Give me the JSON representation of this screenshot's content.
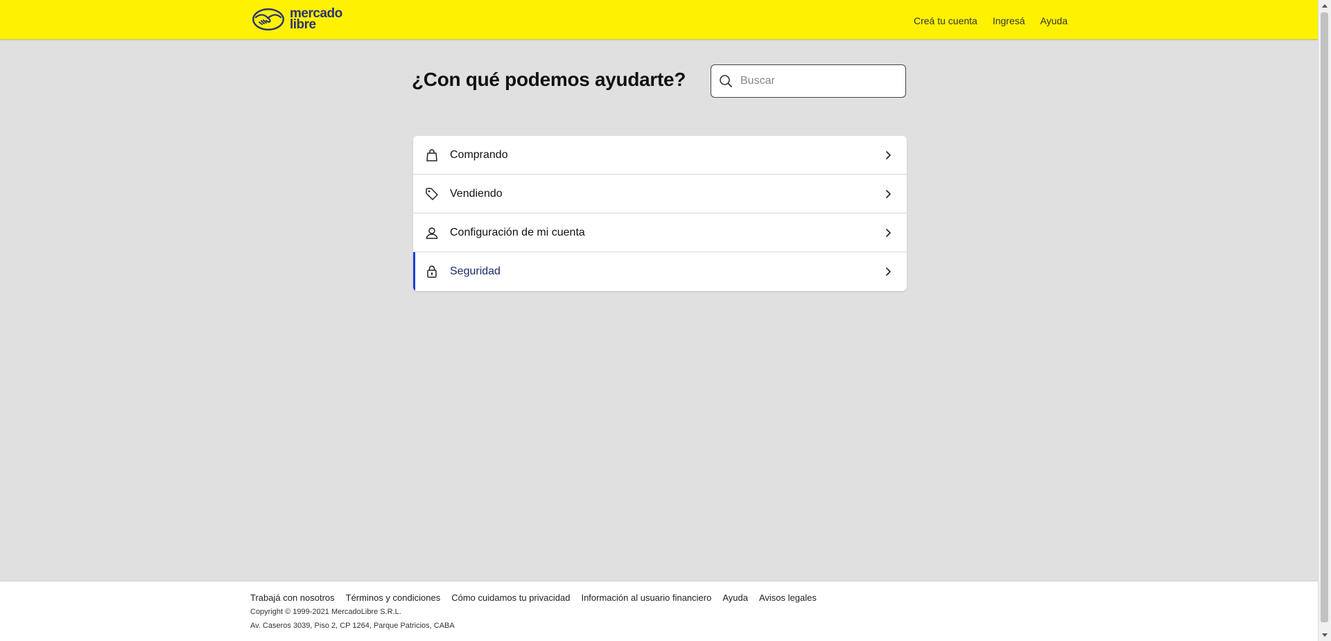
{
  "header": {
    "logo": {
      "line1": "mercado",
      "line2": "libre"
    },
    "nav": {
      "create_account": "Creá tu cuenta",
      "login": "Ingresá",
      "help": "Ayuda"
    }
  },
  "main": {
    "title": "¿Con qué podemos ayudarte?",
    "search": {
      "placeholder": "Buscar",
      "value": ""
    },
    "menu": [
      {
        "label": "Comprando",
        "icon": "shopping-bag-icon"
      },
      {
        "label": "Vendiendo",
        "icon": "price-tag-icon"
      },
      {
        "label": "Configuración de mi cuenta",
        "icon": "user-icon"
      },
      {
        "label": "Seguridad",
        "icon": "lock-icon",
        "active": true
      }
    ]
  },
  "footer": {
    "links": [
      "Trabajá con nosotros",
      "Términos y condiciones",
      "Cómo cuidamos tu privacidad",
      "Información al usuario financiero",
      "Ayuda",
      "Avisos legales"
    ],
    "copyright": "Copyright © 1999-2021 MercadoLibre S.R.L.",
    "address": "Av. Caseros 3039, Piso 2, CP 1264, Parque Patricios, CABA"
  },
  "colors": {
    "header_bg": "#fff200",
    "page_bg": "#e0e0e0",
    "active_accent": "#1a3fd4",
    "brand_blue": "#2d3277"
  }
}
